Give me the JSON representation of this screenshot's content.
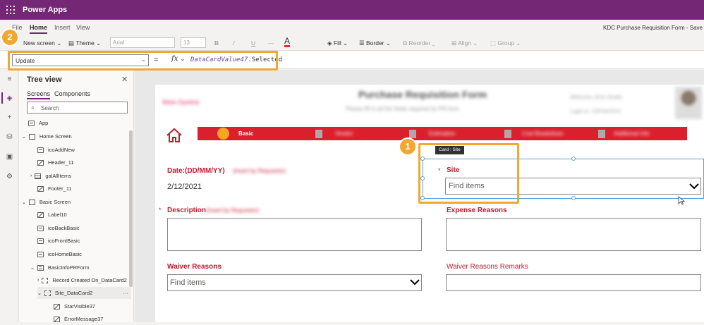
{
  "app": {
    "title": "Power Apps",
    "document_title": "KDC Purchase Requisition Form - Save"
  },
  "menu": {
    "tabs": [
      "File",
      "Home",
      "Insert",
      "View"
    ],
    "active": "Home"
  },
  "ribbon": {
    "new_screen": "New screen",
    "theme": "Theme",
    "font": "Arial",
    "font_size": "13",
    "bold": "B",
    "italic": "/",
    "underline": "U",
    "strike": "—",
    "font_color": "A",
    "fill": "Fill",
    "border": "Border",
    "reorder": "Reorder",
    "align": "Align",
    "group": "Group"
  },
  "formula_bar": {
    "property": "Update",
    "equals": "=",
    "fx": "fx",
    "formula_identifier": "DataCardValue47",
    "formula_rest": ".Selected"
  },
  "annotations": {
    "badge_1": "1",
    "badge_2": "2"
  },
  "tree_view": {
    "title": "Tree view",
    "tabs": [
      "Screens",
      "Components"
    ],
    "search_placeholder": "Search",
    "items": [
      {
        "label": "App",
        "icon": "app-icon"
      },
      {
        "label": "Home Screen",
        "icon": "screen-icon"
      },
      {
        "label": "icoAddNew",
        "icon": "control-icon"
      },
      {
        "label": "Header_11",
        "icon": "label-icon"
      },
      {
        "label": "galAllItems",
        "icon": "gallery-icon"
      },
      {
        "label": "Footer_11",
        "icon": "label-icon"
      },
      {
        "label": "Basic Screen",
        "icon": "screen-icon"
      },
      {
        "label": "Label10",
        "icon": "label-icon"
      },
      {
        "label": "icoBackBasic",
        "icon": "control-icon"
      },
      {
        "label": "icoFrontBasic",
        "icon": "control-icon"
      },
      {
        "label": "icoHomeBasic",
        "icon": "control-icon"
      },
      {
        "label": "BasicInfoPRForm",
        "icon": "form-icon"
      },
      {
        "label": "Record Created On_DataCard2",
        "icon": "card-icon"
      },
      {
        "label": "Site_DataCard2",
        "icon": "card-icon"
      },
      {
        "label": "StarVisible37",
        "icon": "label-icon"
      },
      {
        "label": "ErrorMessage37",
        "icon": "label-icon"
      }
    ]
  },
  "canvas": {
    "header_title": "Purchase Requisition Form",
    "header_subtitle": "Please fill in all the fields required by PR form",
    "header_left": "Moto Dyeline",
    "header_right_1": "Welcome, Arch Studio",
    "header_right_2": "Login in: 12/Feb/2021",
    "nav": {
      "basic": "Basic",
      "tab2": "Vendor",
      "tab3": "Estimation",
      "tab4": "Cost Breakdown",
      "tab5": "Additional Info"
    },
    "tooltip": "Card : Site",
    "fields": {
      "date_label": "Date:(DD/MM/YY)",
      "date_hint": "(Insert by Requestor)",
      "date_value": "2/12/2021",
      "site_label": "Site",
      "site_placeholder": "Find items",
      "description_label": "Description",
      "description_hint": "(Insert by Requestor)",
      "expense_label": "Expense Reasons",
      "waiver_label": "Waiver Reasons",
      "waiver_placeholder": "Find items",
      "waiver_remarks_label": "Waiver Reasons Remarks",
      "required_mark": "*"
    }
  },
  "colors": {
    "brand": "#742774",
    "accent_red": "#c4182f",
    "nav_red": "#d9202c",
    "annotation": "#f0a830",
    "selection": "#5aa1d5"
  }
}
